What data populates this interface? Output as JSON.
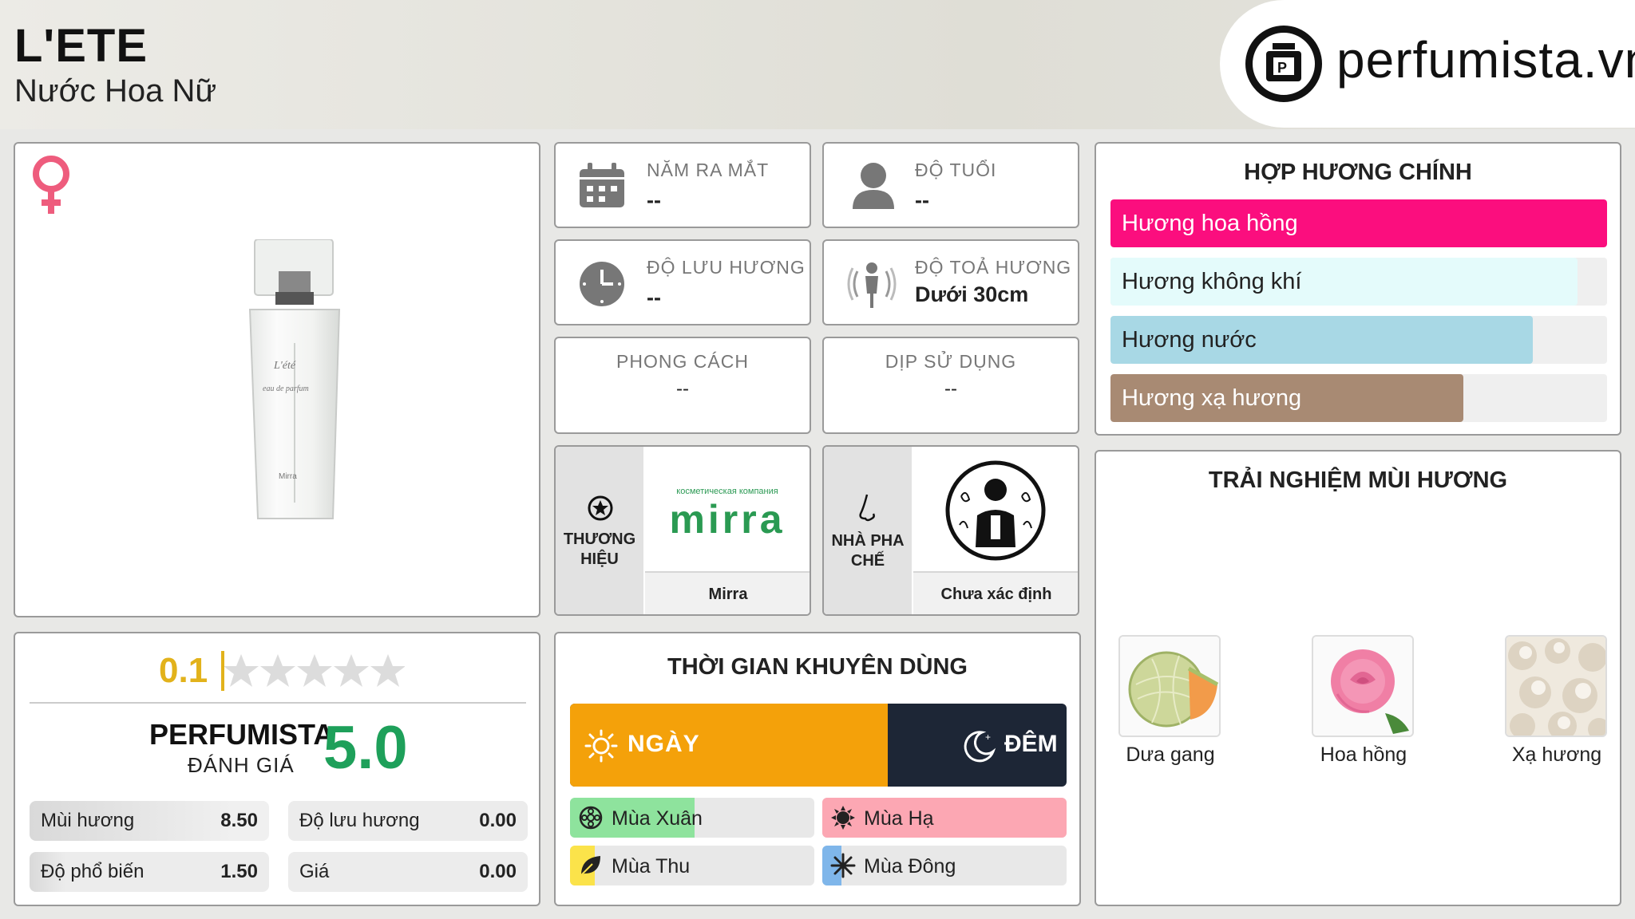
{
  "header": {
    "title": "L'ETE",
    "subtitle": "Nước Hoa Nữ",
    "logo_text": "perfumista.vn"
  },
  "rating": {
    "user_score": "0.1",
    "stars_max": 5,
    "perfumista_label": "PERFUMISTA",
    "perfumista_sub": "ĐÁNH GIÁ",
    "perfumista_score": "5.0",
    "metrics": [
      {
        "label": "Mùi hương",
        "value": "8.50",
        "level": 0.85
      },
      {
        "label": "Độ lưu hương",
        "value": "0.00",
        "level": 0
      },
      {
        "label": "Độ phổ biến",
        "value": "1.50",
        "level": 0.15
      },
      {
        "label": "Giá",
        "value": "0.00",
        "level": 0
      }
    ]
  },
  "info": {
    "launch_year": {
      "label": "NĂM RA MẮT",
      "value": "--"
    },
    "age": {
      "label": "ĐỘ TUỔI",
      "value": "--"
    },
    "longevity": {
      "label": "ĐỘ LƯU HƯƠNG",
      "value": "--"
    },
    "sillage": {
      "label": "ĐỘ TOẢ HƯƠNG",
      "value": "Dưới 30cm"
    },
    "style": {
      "label": "PHONG CÁCH",
      "value": "--"
    },
    "occasion": {
      "label": "DỊP SỬ DỤNG",
      "value": "--"
    },
    "brand": {
      "caption_1": "THƯƠNG",
      "caption_2": "HIỆU",
      "logo_small": "косметическая компания",
      "logo_big": "mirra",
      "name": "Mirra"
    },
    "perfumer": {
      "caption_1": "NHÀ PHA",
      "caption_2": "CHẾ",
      "name": "Chưa xác định"
    }
  },
  "accords": {
    "title": "HỢP HƯƠNG CHÍNH",
    "items": [
      {
        "label": "Hương hoa hồng",
        "level": 1.0,
        "color": "#fb0e7e"
      },
      {
        "label": "Hương không khí",
        "level": 0.94,
        "color": "#e4fbfb"
      },
      {
        "label": "Hương nước",
        "level": 0.85,
        "color": "#a8d8e5"
      },
      {
        "label": "Hương xạ hương",
        "level": 0.71,
        "color": "#a88a73"
      }
    ]
  },
  "recommended_time": {
    "title": "THỜI GIAN KHUYÊN DÙNG",
    "day_label": "NGÀY",
    "night_label": "ĐÊM",
    "day_level": 0.64,
    "seasons": [
      {
        "label": "Mùa Xuân",
        "level": 0.51,
        "color": "#8ee39d"
      },
      {
        "label": "Mùa Hạ",
        "level": 1.0,
        "color": "#fca7b3"
      },
      {
        "label": "Mùa Thu",
        "level": 0.1,
        "color": "#fbe34a"
      },
      {
        "label": "Mùa Đông",
        "level": 0.08,
        "color": "#7fb6ea"
      }
    ]
  },
  "experience": {
    "title": "TRẢI NGHIỆM MÙI HƯƠNG",
    "notes": [
      {
        "label": "Dưa gang",
        "icon": "melon-image"
      },
      {
        "label": "Hoa hồng",
        "icon": "rose-image"
      },
      {
        "label": "Xạ hương",
        "icon": "musk-image"
      }
    ]
  },
  "colors": {
    "accent_green": "#1ea05a",
    "star_gold": "#e2b21b",
    "venus_pink": "#ee5c7d",
    "day_orange": "#f4a10a",
    "night_navy": "#1d2636"
  }
}
